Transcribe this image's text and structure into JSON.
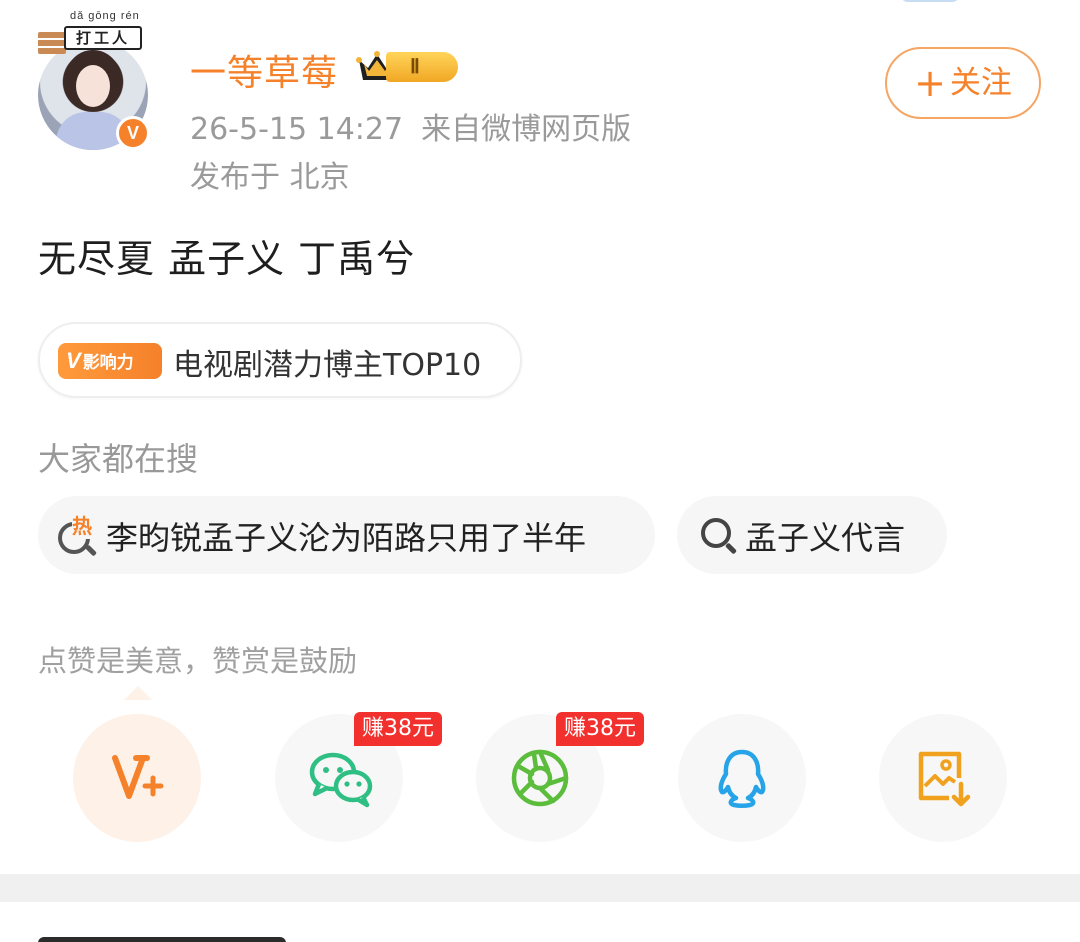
{
  "user": {
    "name": "一等草莓",
    "rank_numeral": "Ⅱ",
    "verified_mark": "V",
    "hat_pinyin": "dǎ gōng rén",
    "hat_text": "打工人"
  },
  "post": {
    "timestamp": "26-5-15 14:27",
    "source": "来自微博网页版",
    "location": "发布于 北京",
    "text": "无尽夏 孟子义 丁禹兮"
  },
  "follow": {
    "label": "关注",
    "icon": "plus-icon"
  },
  "influence": {
    "tag_v": "V",
    "tag_text": "影响力",
    "label": "电视剧潜力博主TOP10"
  },
  "search": {
    "heading": "大家都在搜",
    "items": [
      {
        "text": "李昀锐孟子义沦为陌路只用了半年",
        "hot_label": "热",
        "icon": "hot-search-icon"
      },
      {
        "text": "孟子义代言",
        "icon": "search-icon"
      }
    ]
  },
  "reward": {
    "text": "点赞是美意，赞赏是鼓励"
  },
  "share": {
    "items": [
      {
        "name": "vplus",
        "icon": "v-plus-icon",
        "color": "#f5822a"
      },
      {
        "name": "wechat",
        "icon": "wechat-icon",
        "color": "#2fbf84",
        "earn": "赚38元"
      },
      {
        "name": "moments",
        "icon": "moments-icon",
        "color": "#5cbd3c",
        "earn": "赚38元"
      },
      {
        "name": "qq",
        "icon": "qq-icon",
        "color": "#27a4e8"
      },
      {
        "name": "save-image",
        "icon": "save-image-icon",
        "color": "#f0a21f"
      }
    ]
  },
  "colors": {
    "accent": "#f5822a",
    "earn_badge": "#f2312e",
    "muted_text": "#9a9a9a"
  }
}
